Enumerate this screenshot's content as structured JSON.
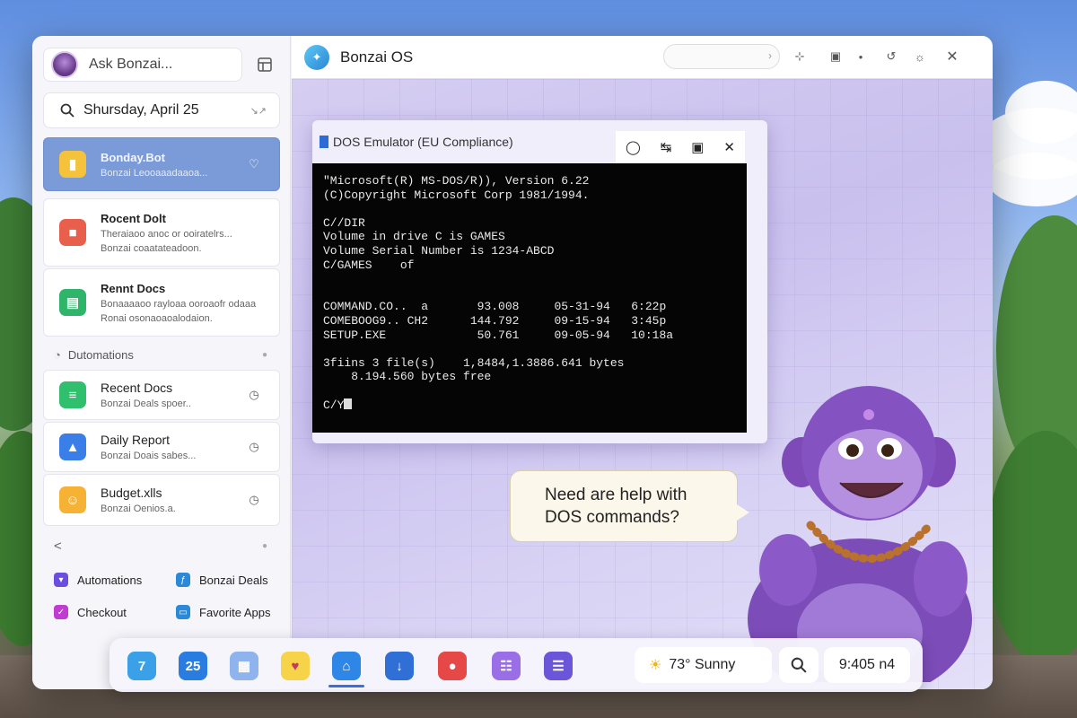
{
  "sidebar": {
    "ask_placeholder": "Ask Bonzai...",
    "date": "Shursday, April 25",
    "cards": [
      {
        "title": "Bonday.Bot",
        "sub": "Bonzai Leooaaadaaoa...",
        "icon": "folder-icon",
        "color": "#f5c33b"
      },
      {
        "title": "Rocent Dolt",
        "sub": "Theraiaoo anoc or ooiratelrs...",
        "sub2": "Bonzai coaatateadoon.",
        "icon": "gift-icon",
        "color": "#e8604c"
      },
      {
        "title": "Rennt Docs",
        "sub": "Bonaaaaoo rayloaa ooroaofr odaaa",
        "sub2": "Ronai osonaoaoalodaion.",
        "icon": "document-icon",
        "color": "#2fb56a"
      }
    ],
    "automations_header": "Dutomations",
    "automations": [
      {
        "title": "Recent Docs",
        "sub": "Bonzai Deals spoer..",
        "icon": "chart-icon",
        "color": "#2fbf6d"
      },
      {
        "title": "Daily Report",
        "sub": "Bonzai Doais sabes...",
        "icon": "tag-icon",
        "color": "#3a7ee8"
      },
      {
        "title": "Budget.xlls",
        "sub": "Bonzai Oenios.a.",
        "icon": "budget-icon",
        "color": "#f5b235"
      }
    ],
    "back_symbol": "<",
    "links": [
      {
        "label": "Automations",
        "icon": "automation-icon",
        "color": "#6b4ee0"
      },
      {
        "label": "Bonzai Deals",
        "icon": "deals-icon",
        "color": "#2a8ad8"
      },
      {
        "label": "Checkout",
        "icon": "checkout-icon",
        "color": "#c03bd0"
      },
      {
        "label": "Favorite Apps",
        "icon": "favorite-apps-icon",
        "color": "#2a8ad8"
      }
    ]
  },
  "window": {
    "title": "Bonzai OS"
  },
  "dos": {
    "title": "DOS Emulator (EU Compliance)",
    "lines": [
      "\"Microsoft(R) MS-DOS/R)), Version 6.22",
      "(C)Copyright Microsoft Corp 1981/1994.",
      "",
      "C//DIR",
      "Volume in drive C is GAMES",
      "Volume Serial Number is 1234-ABCD",
      "C/GAMES    of",
      "",
      "COMMAND.CO..  a       93.008     05-31-94   6:22p",
      "COMEBOOG9.. CH2      144.792     09-15-94   3:45p",
      "SETUP.EXE             50.761     09-05-94   10:18a",
      "",
      "3fiins 3 file(s)    1,8484,1.3886.641 bytes",
      "    8.194.560 bytes free",
      "",
      "C/Y"
    ]
  },
  "assistant": {
    "bubble_line1": "Need are help with",
    "bubble_line2": "DOS commands?"
  },
  "dock": {
    "apps": [
      {
        "name": "app-1",
        "color": "#3aa0e8",
        "glyph": "7"
      },
      {
        "name": "app-2",
        "color": "#2a7de0",
        "glyph": "25"
      },
      {
        "name": "app-3",
        "color": "#8fb3ec",
        "glyph": "▦"
      },
      {
        "name": "app-4",
        "color": "#f7d34a",
        "glyph": "♥"
      },
      {
        "name": "app-5",
        "color": "#2e86e6",
        "glyph": "⌂"
      },
      {
        "name": "app-6",
        "color": "#2f6fd6",
        "glyph": "↓"
      },
      {
        "name": "app-7",
        "color": "#e64848",
        "glyph": "●"
      },
      {
        "name": "app-8",
        "color": "#9a6ee6",
        "glyph": "☷"
      },
      {
        "name": "app-9",
        "color": "#6b55d8",
        "glyph": "☰"
      }
    ],
    "weather": "73° Sunny",
    "clock": "9:405 n4"
  }
}
